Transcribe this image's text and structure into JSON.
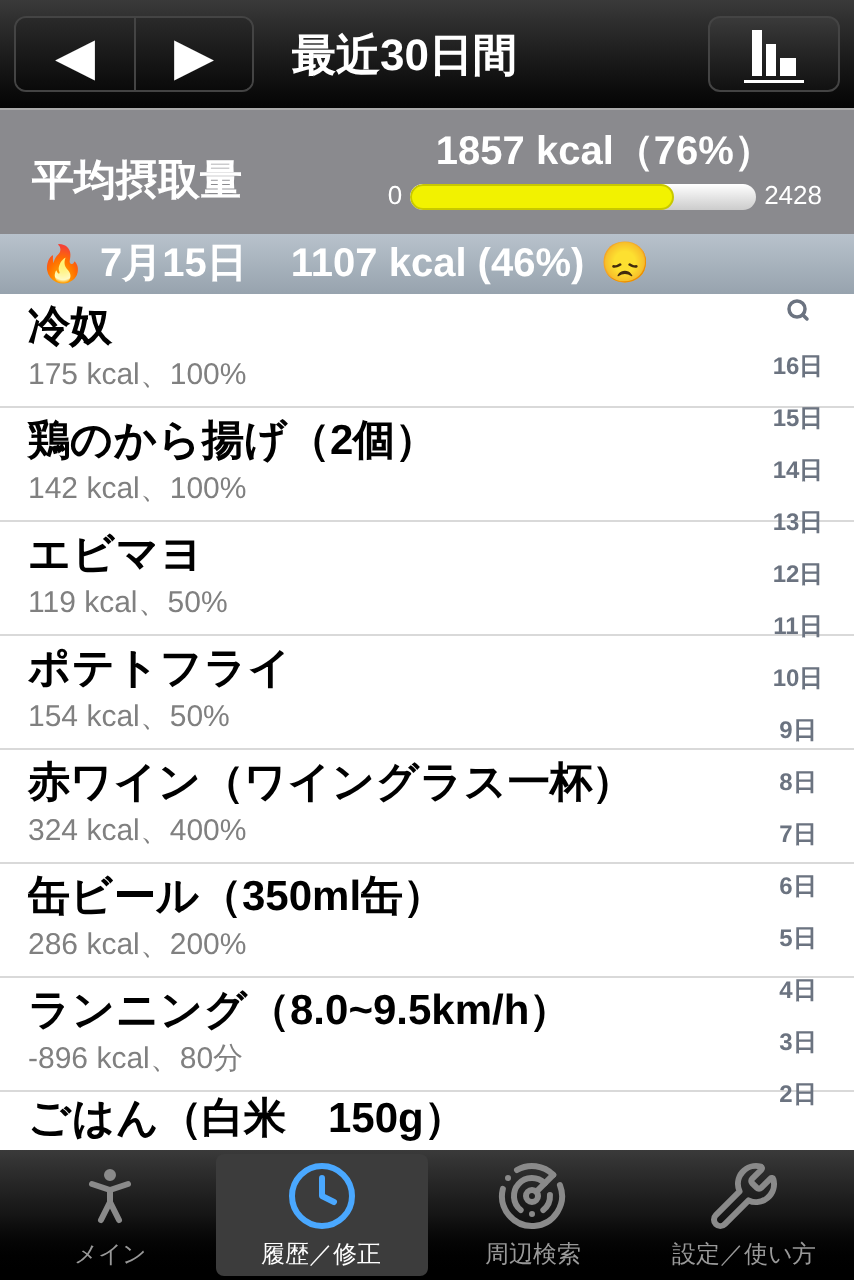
{
  "nav": {
    "prev": "◀",
    "next": "▶",
    "title": "最近30日間"
  },
  "summary": {
    "label": "平均摂取量",
    "value": "1857 kcal（76%）",
    "min": "0",
    "max": "2428",
    "level": 0.76
  },
  "day_header": {
    "icon": "🔥",
    "date": "7月15日",
    "value": "1107 kcal (46%)",
    "mood": "😞"
  },
  "entries": [
    {
      "name": "冷奴",
      "detail": "175 kcal、100%"
    },
    {
      "name": "鶏のから揚げ（2個）",
      "detail": "142 kcal、100%"
    },
    {
      "name": "エビマヨ",
      "detail": "119 kcal、50%"
    },
    {
      "name": "ポテトフライ",
      "detail": "154 kcal、50%"
    },
    {
      "name": "赤ワイン（ワイングラス一杯）",
      "detail": "324 kcal、400%"
    },
    {
      "name": "缶ビール（350ml缶）",
      "detail": "286 kcal、200%"
    },
    {
      "name": "ランニング（8.0~9.5km/h）",
      "detail": "-896 kcal、80分"
    },
    {
      "name": "ごはん（白米　150g）"
    }
  ],
  "index": [
    "16日",
    "15日",
    "14日",
    "13日",
    "12日",
    "11日",
    "10日",
    "9日",
    "8日",
    "7日",
    "6日",
    "5日",
    "4日",
    "3日",
    "2日"
  ],
  "tabs": [
    {
      "label": "メイン",
      "selected": false
    },
    {
      "label": "履歴／修正",
      "selected": true
    },
    {
      "label": "周辺検索",
      "selected": false
    },
    {
      "label": "設定／使い方",
      "selected": false
    }
  ]
}
